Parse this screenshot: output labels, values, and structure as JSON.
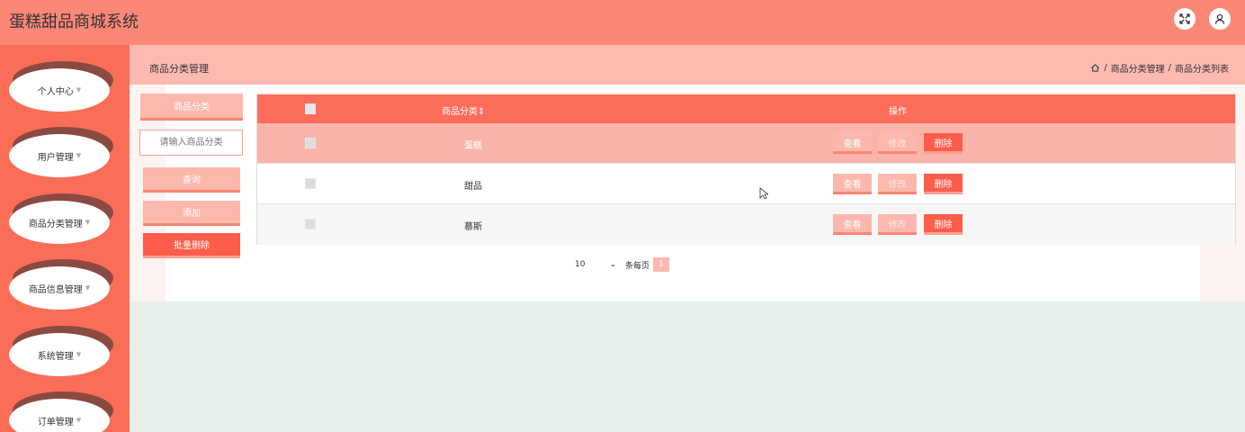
{
  "app": {
    "title": "蛋糕甜品商城系统"
  },
  "sidebar": {
    "items": [
      {
        "label": "个人中心"
      },
      {
        "label": "用户管理"
      },
      {
        "label": "商品分类管理"
      },
      {
        "label": "商品信息管理"
      },
      {
        "label": "系统管理"
      },
      {
        "label": "订单管理"
      }
    ]
  },
  "header": {
    "page_title": "商品分类管理",
    "breadcrumb": [
      "商品分类管理",
      "商品分类列表"
    ],
    "breadcrumb_sep": "/"
  },
  "filter": {
    "label": "商品分类",
    "placeholder": "请输入商品分类",
    "query_label": "查询",
    "add_label": "添加",
    "batch_delete_label": "批量删除"
  },
  "table": {
    "columns": [
      "商品分类",
      "操作"
    ],
    "sort_icon": "⇕",
    "rows": [
      {
        "name": "蛋糕"
      },
      {
        "name": "甜品"
      },
      {
        "name": "慕斯"
      }
    ],
    "actions": {
      "view": "查看",
      "edit": "修改",
      "delete": "删除"
    }
  },
  "pagination": {
    "page_size": "10",
    "per_page_label": "条每页",
    "current_page": "1"
  },
  "colors": {
    "topbar": "#fb8877",
    "sidebar": "#fa6e58",
    "accent": "#fd5d4a",
    "light_accent": "#fdb8ad"
  }
}
